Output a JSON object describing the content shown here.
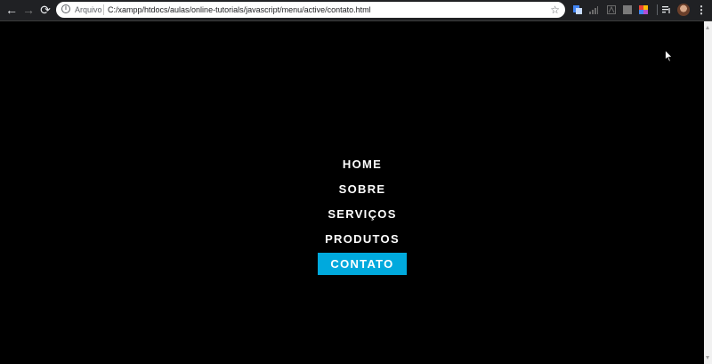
{
  "browser": {
    "url_scheme_label": "Arquivo",
    "url": "C:/xampp/htdocs/aulas/online-tutorials/javascript/menu/active/contato.html",
    "buttons": {
      "back": "←",
      "forward": "→",
      "reload": "⟳",
      "bookmark": "☆",
      "more": "⋮"
    },
    "colors": {
      "toolbar": "#202124",
      "omnibox": "#ffffff"
    }
  },
  "menu": {
    "items": [
      {
        "label": "HOME",
        "active": false
      },
      {
        "label": "SOBRE",
        "active": false
      },
      {
        "label": "SERVIÇOS",
        "active": false
      },
      {
        "label": "PRODUTOS",
        "active": false
      },
      {
        "label": "CONTATO",
        "active": true
      }
    ],
    "active_color": "#00a9dd",
    "text_color": "#ffffff"
  },
  "page": {
    "background": "#000000"
  }
}
